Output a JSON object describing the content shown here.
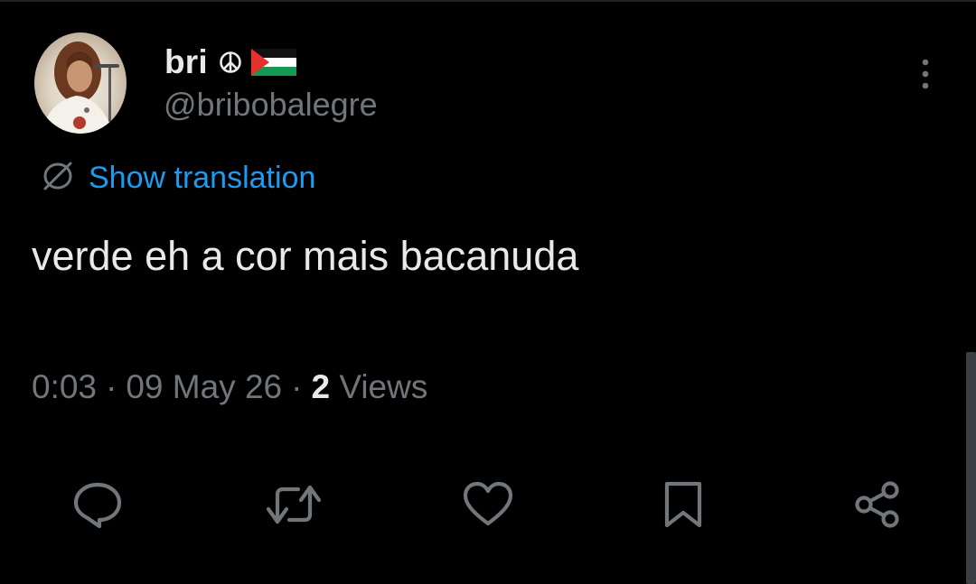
{
  "author": {
    "display_name": "bri",
    "handle": "@bribobalegre",
    "name_emojis": [
      "peace-symbol",
      "palestine-flag"
    ]
  },
  "translation": {
    "label": "Show translation"
  },
  "tweet": {
    "text": "verde eh a cor mais bacanuda"
  },
  "meta": {
    "time": "0:03",
    "separator": "·",
    "date": "09 May 26",
    "views_count": "2",
    "views_label": "Views"
  },
  "actions": [
    "reply-icon",
    "retweet-icon",
    "like-icon",
    "bookmark-icon",
    "share-icon"
  ],
  "colors": {
    "background": "#000000",
    "text_primary": "#e7e9ea",
    "text_secondary": "#71767b",
    "link": "#1d9bf0"
  }
}
